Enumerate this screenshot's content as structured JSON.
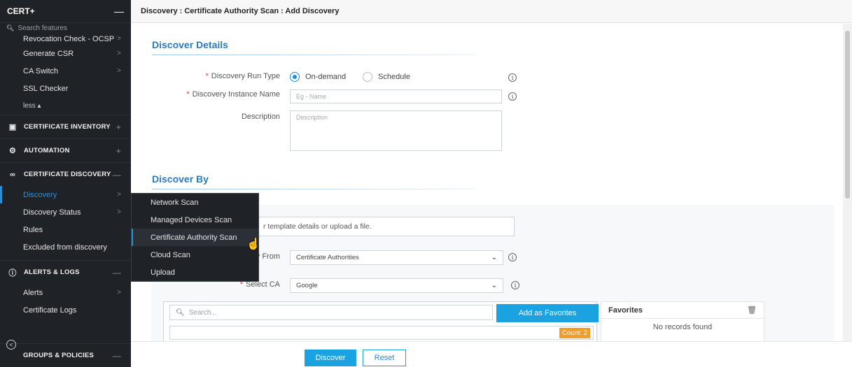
{
  "sidebar": {
    "title": "CERT+",
    "collapse_icon": "minus-icon",
    "search_placeholder": "Search features",
    "top_items": [
      {
        "label": "Revocation Check - OCSP"
      },
      {
        "label": "Generate CSR"
      },
      {
        "label": "CA Switch"
      },
      {
        "label": "SSL Checker"
      }
    ],
    "less_label": "less ▴",
    "sections": {
      "inventory": "CERTIFICATE INVENTORY",
      "automation": "AUTOMATION",
      "discovery": "CERTIFICATE DISCOVERY",
      "alerts": "ALERTS & LOGS",
      "groups": "GROUPS & POLICIES"
    },
    "discovery_items": [
      {
        "label": "Discovery"
      },
      {
        "label": "Discovery Status"
      },
      {
        "label": "Rules"
      },
      {
        "label": "Excluded from discovery"
      }
    ],
    "alerts_items": [
      {
        "label": "Alerts"
      },
      {
        "label": "Certificate Logs"
      }
    ]
  },
  "flyout": {
    "items": [
      {
        "label": "Network Scan"
      },
      {
        "label": "Managed Devices Scan"
      },
      {
        "label": "Certificate Authority Scan"
      },
      {
        "label": "Cloud Scan"
      },
      {
        "label": "Upload"
      }
    ],
    "hovered_index": 2
  },
  "breadcrumb": "Discovery : Certificate Authority Scan : Add Discovery",
  "discover_details": {
    "title": "Discover Details",
    "run_type_label": "Discovery Run Type",
    "run_type_options": [
      "On-demand",
      "Schedule"
    ],
    "run_type_selected": "On-demand",
    "instance_name_label": "Discovery Instance Name",
    "instance_name_placeholder": "Eg - Name",
    "description_label": "Description",
    "description_placeholder": "Description"
  },
  "discover_by": {
    "title": "Discover By",
    "upload_text": "r template details or upload a file.",
    "discover_from_label": "y From",
    "discover_from_value": "Certificate Authorities",
    "select_ca_label": "Select CA",
    "select_ca_value": "Google",
    "search_placeholder": "Search...",
    "add_favorites_label": "Add as Favorites",
    "count_label": "Count: 2",
    "favorites_title": "Favorites",
    "favorites_empty": "No records found"
  },
  "footer": {
    "discover_label": "Discover",
    "reset_label": "Reset"
  },
  "colors": {
    "accent": "#1aa3e0",
    "sidebar_bg": "#1f2226",
    "section_title": "#2b7bbf",
    "count_badge": "#f39c2b"
  }
}
